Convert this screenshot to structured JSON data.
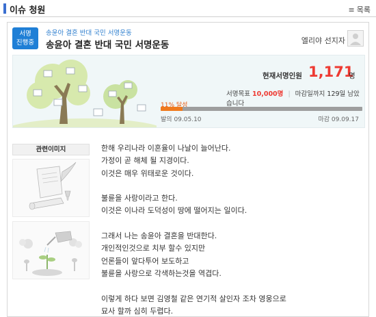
{
  "header": {
    "title": "이슈 청원",
    "menu_icon": "list-icon",
    "menu_label": "목록"
  },
  "petition": {
    "status_line1": "서명",
    "status_line2": "진행중",
    "breadcrumb": "송윤아 결혼 반대 국민 서명운동",
    "title": "송윤아 결혼 반대 국민 서명운동",
    "author": "엘리야 선지자"
  },
  "stats": {
    "current_label": "현재서명인원",
    "current_count": "1,171",
    "current_unit": "명",
    "goal_label": "서명목표",
    "goal_value": "10,000명",
    "deadline_text_pre": "마감일까지",
    "deadline_days": "129일",
    "deadline_text_post": "남았습니다",
    "achievement_label": "11% 달성",
    "progress_fraction": 0.11,
    "start_label": "발의",
    "start_date": "09.05.10",
    "end_label": "마감",
    "end_date": "09.09.17"
  },
  "related": {
    "heading": "관련이미지"
  },
  "body_lines": [
    "한해 우리나라 이혼율이 나날이 늘어난다.",
    "가정이 곧 해체 될 지경이다.",
    "이것은 매우 위태로운 것이다.",
    "",
    "불륜을 사랑이라고 한다.",
    "이것은 이나라 도덕성이 땅에 떨어지는 일이다.",
    "",
    "그래서 나는 송윤아 결혼을 반대한다.",
    "개인적인것으로 치부 할수 있지만",
    "언론들이 앞다투어 보도하고",
    "불륜을 사랑으로 각색하는것을 역겹다.",
    "",
    "이렇게 하다 보면 김영철 같은 연기적 살인자 조차 영웅으로",
    "묘사 할까 심히 두렵다."
  ],
  "colors": {
    "accent_blue": "#1f7fd6",
    "count_red": "#ee3a32",
    "progress_orange": "#ef7a1e"
  }
}
